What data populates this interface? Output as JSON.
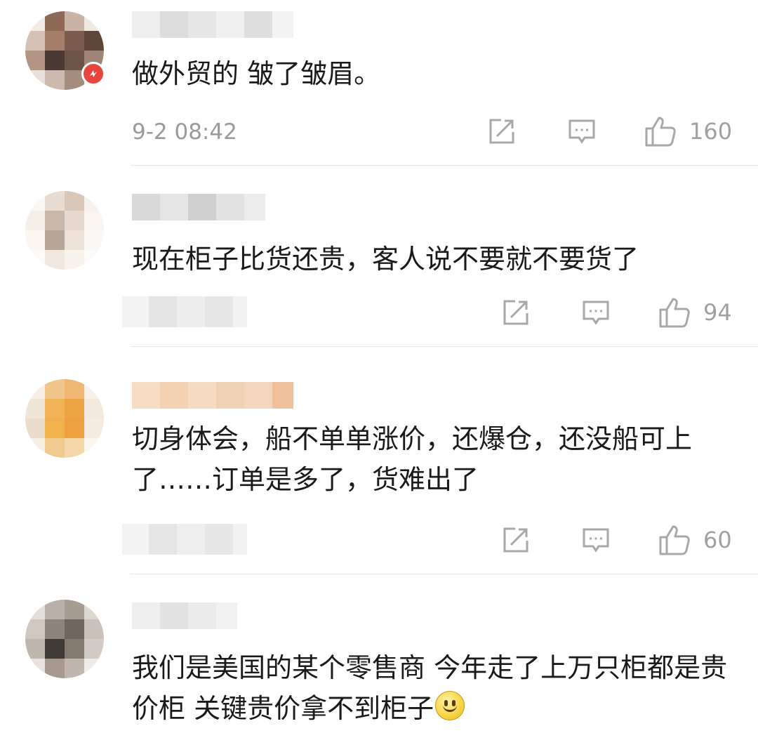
{
  "comments": [
    {
      "text": "做外贸的 皱了皱眉。",
      "time": "9-2 08:42",
      "likes": "160"
    },
    {
      "text": "现在柜子比货还贵，客人说不要就不要货了",
      "likes": "94"
    },
    {
      "text": "切身体会，船不单单涨价，还爆仓，还没船可上了……订单是多了，货难出了",
      "likes": "60"
    },
    {
      "text": "我们是美国的某个零售商 今年走了上万只柜都是贵价柜 关键贵价拿不到柜子",
      "emoji": "smile-emoji"
    }
  ],
  "icons": {
    "share": "share-icon",
    "comment": "comment-icon",
    "like": "thumbs-up-icon",
    "verified": "verified-badge-icon"
  },
  "colors": {
    "text": "#1a1a1a",
    "meta": "#9a9a9a",
    "divider": "#e8e8e8",
    "badge": "#e8463c"
  }
}
